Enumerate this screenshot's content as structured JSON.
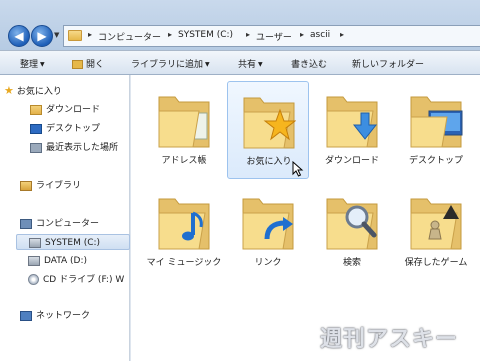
{
  "address": {
    "crumbs": [
      "コンピューター",
      "SYSTEM (C:)",
      "ユーザー",
      "ascii"
    ]
  },
  "toolbar": {
    "organize": "整理",
    "open": "開く",
    "include_library": "ライブラリに追加",
    "share": "共有",
    "burn": "書き込む",
    "new_folder": "新しいフォルダー"
  },
  "nav": {
    "favorites": "お気に入り",
    "downloads": "ダウンロード",
    "desktop": "デスクトップ",
    "recent": "最近表示した場所",
    "libraries": "ライブラリ",
    "computer": "コンピューター",
    "system_drive": "SYSTEM (C:)",
    "data_drive": "DATA (D:)",
    "cd_drive": "CD ドライブ (F:) W",
    "network": "ネットワーク"
  },
  "folders": [
    {
      "label": "アドレス帳",
      "icon": "address-book-icon"
    },
    {
      "label": "お気に入り",
      "icon": "star-icon"
    },
    {
      "label": "ダウンロード",
      "icon": "download-arrow-icon"
    },
    {
      "label": "デスクトップ",
      "icon": "monitor-icon"
    },
    {
      "label": "マイ ミュージック",
      "icon": "music-note-icon"
    },
    {
      "label": "リンク",
      "icon": "link-arrow-icon"
    },
    {
      "label": "検索",
      "icon": "magnifier-icon"
    },
    {
      "label": "保存したゲーム",
      "icon": "chess-piece-icon"
    }
  ],
  "watermark": "週刊アスキー"
}
